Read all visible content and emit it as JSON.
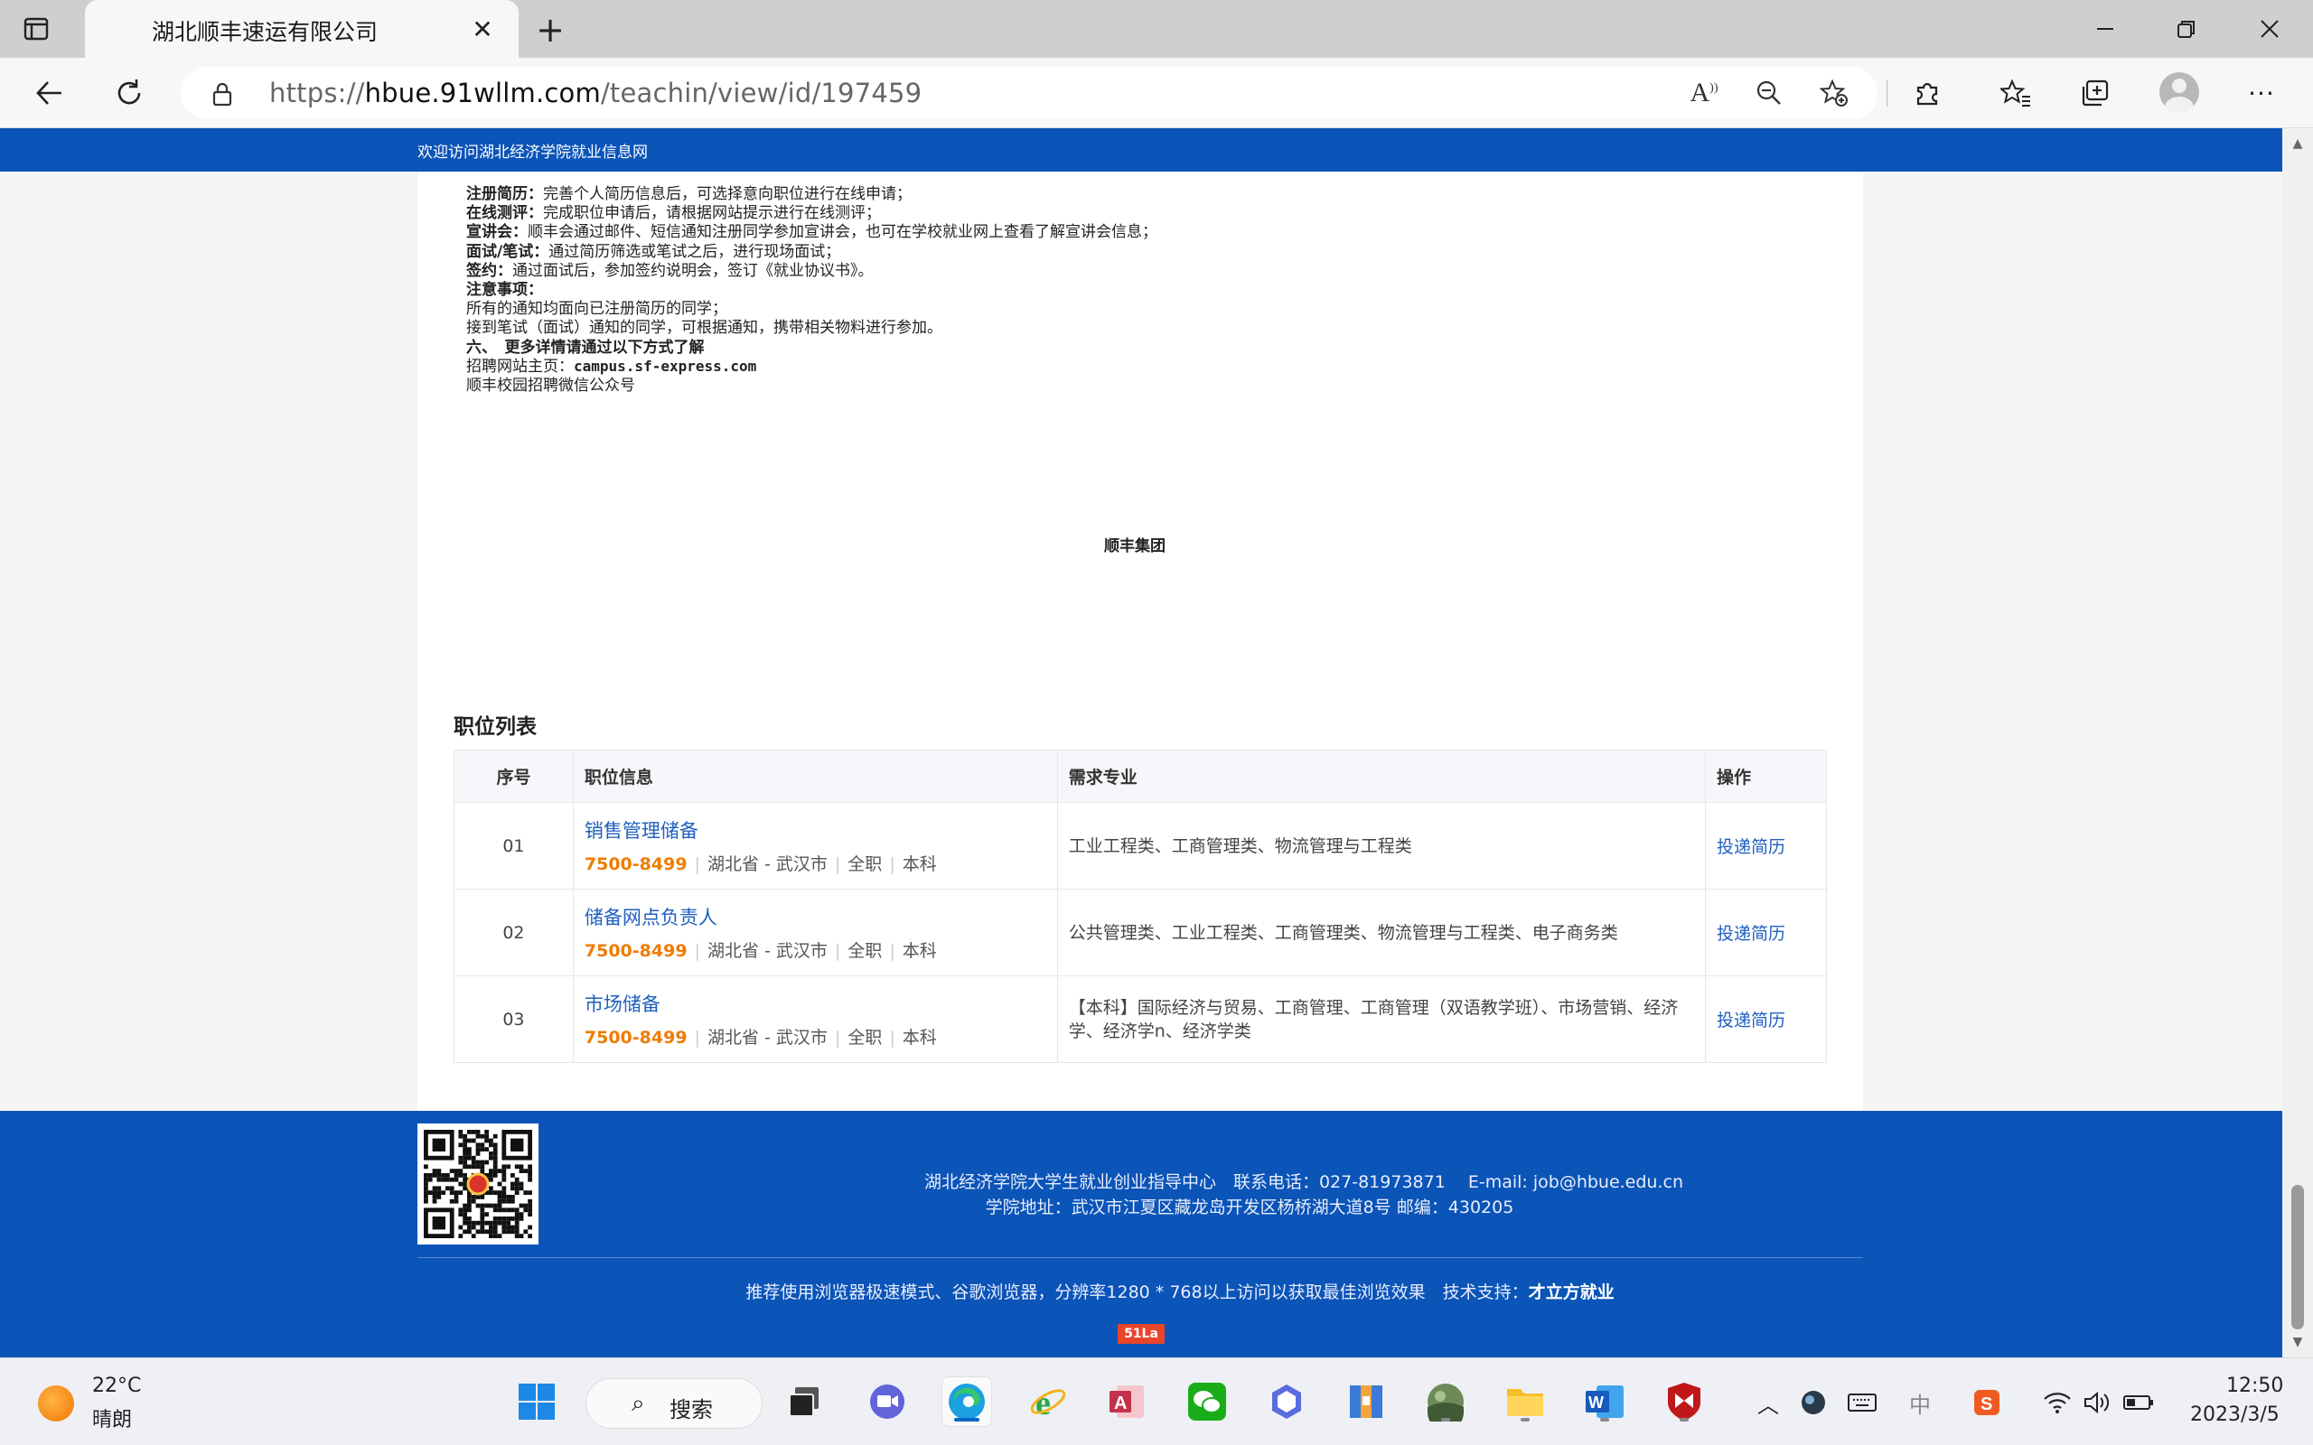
{
  "browser": {
    "tab_title": "湖北顺丰速运有限公司",
    "url_scheme": "https://",
    "url_host": "hbue.91wllm.com",
    "url_path": "/teachin/view/id/197459"
  },
  "site": {
    "welcome": "欢迎访问湖北经济学院就业信息网"
  },
  "article": {
    "lines": [
      {
        "label": "注册简历：",
        "text": "完善个人简历信息后，可选择意向职位进行在线申请；"
      },
      {
        "label": "在线测评：",
        "text": "完成职位申请后，请根据网站提示进行在线测评；"
      },
      {
        "label": "宣讲会：",
        "text": "顺丰会通过邮件、短信通知注册同学参加宣讲会，也可在学校就业网上查看了解宣讲会信息；"
      },
      {
        "label": "面试/笔试：",
        "text": "通过简历筛选或笔试之后，进行现场面试；"
      },
      {
        "label": "签约：",
        "text": "通过面试后，参加签约说明会，签订《就业协议书》。"
      },
      {
        "label": "注意事项：",
        "text": ""
      },
      {
        "label": "",
        "text": "所有的通知均面向已注册简历的同学；"
      },
      {
        "label": "",
        "text": "接到笔试（面试）通知的同学，可根据通知，携带相关物料进行参加。"
      },
      {
        "label": "六、　更多详情请通过以下方式了解",
        "text": ""
      },
      {
        "label": "",
        "text": "招聘网站主页：",
        "mono": "campus.sf-express.com"
      },
      {
        "label": "",
        "text": "顺丰校园招聘微信公众号"
      }
    ],
    "signature": "顺丰集团"
  },
  "jobs": {
    "section_title": "职位列表",
    "headers": {
      "no": "序号",
      "info": "职位信息",
      "major": "需求专业",
      "op": "操作"
    },
    "rows": [
      {
        "no": "01",
        "title": "销售管理储备",
        "salary": "7500-8499",
        "location": "湖北省 - 武汉市",
        "type": "全职",
        "degree": "本科",
        "major": "工业工程类、工商管理类、物流管理与工程类",
        "action": "投递简历"
      },
      {
        "no": "02",
        "title": "储备网点负责人",
        "salary": "7500-8499",
        "location": "湖北省 - 武汉市",
        "type": "全职",
        "degree": "本科",
        "major": "公共管理类、工业工程类、工商管理类、物流管理与工程类、电子商务类",
        "action": "投递简历"
      },
      {
        "no": "03",
        "title": "市场储备",
        "salary": "7500-8499",
        "location": "湖北省 - 武汉市",
        "type": "全职",
        "degree": "本科",
        "major": "【本科】国际经济与贸易、工商管理、工商管理（双语教学班）、市场营销、经济学、经济学n、经济学类",
        "action": "投递简历"
      }
    ]
  },
  "footer": {
    "line1": "湖北经济学院大学生就业创业指导中心　联系电话：027-81973871　 E-mail: job@hbue.edu.cn",
    "line2": "学院地址：武汉市江夏区藏龙岛开发区杨桥湖大道8号 邮编：430205",
    "line3": "推荐使用浏览器极速模式、谷歌浏览器，分辨率1280 * 768以上访问以获取最佳浏览效果　技术支持：",
    "tech_support": "才立方就业",
    "badge": "51La"
  },
  "taskbar": {
    "temperature": "22°C",
    "weather": "晴朗",
    "search_label": "搜索",
    "time": "12:50",
    "date": "2023/3/5",
    "ime": "中"
  },
  "colors": {
    "brand_blue": "#0b54b8",
    "link_blue": "#1f5fbf",
    "salary_orange": "#f07c00"
  }
}
